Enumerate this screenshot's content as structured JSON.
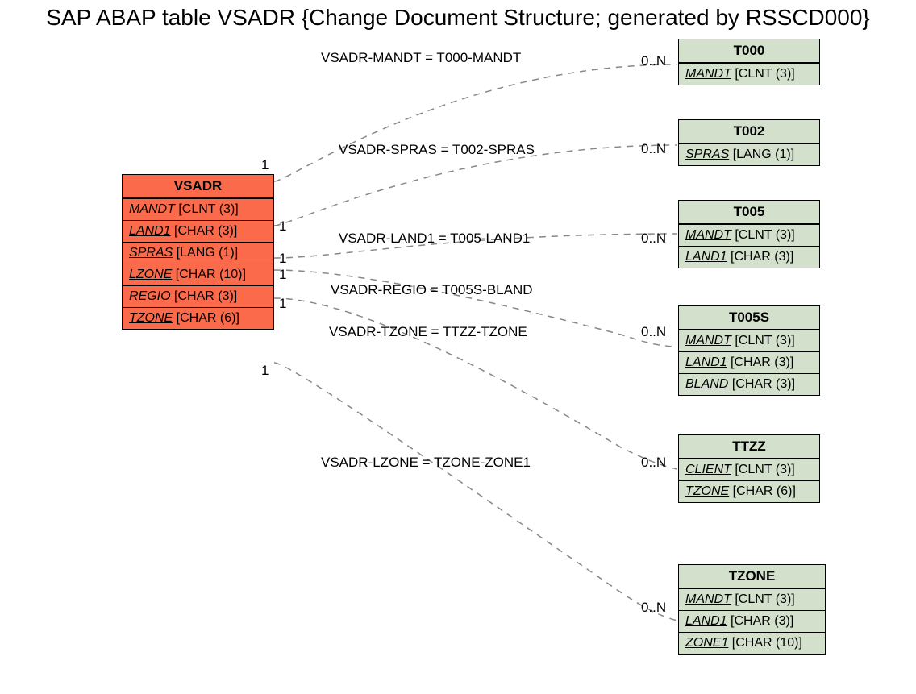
{
  "title": "SAP ABAP table VSADR {Change Document Structure; generated by RSSCD000}",
  "main": {
    "name": "VSADR",
    "fields": [
      {
        "f": "MANDT",
        "t": "[CLNT (3)]"
      },
      {
        "f": "LAND1",
        "t": "[CHAR (3)]"
      },
      {
        "f": "SPRAS",
        "t": "[LANG (1)]"
      },
      {
        "f": "LZONE",
        "t": "[CHAR (10)]"
      },
      {
        "f": "REGIO",
        "t": "[CHAR (3)]"
      },
      {
        "f": "TZONE",
        "t": "[CHAR (6)]"
      }
    ]
  },
  "refs": [
    {
      "name": "T000",
      "fields": [
        {
          "f": "MANDT",
          "t": "[CLNT (3)]"
        }
      ]
    },
    {
      "name": "T002",
      "fields": [
        {
          "f": "SPRAS",
          "t": "[LANG (1)]"
        }
      ]
    },
    {
      "name": "T005",
      "fields": [
        {
          "f": "MANDT",
          "t": "[CLNT (3)]"
        },
        {
          "f": "LAND1",
          "t": "[CHAR (3)]"
        }
      ]
    },
    {
      "name": "T005S",
      "fields": [
        {
          "f": "MANDT",
          "t": "[CLNT (3)]"
        },
        {
          "f": "LAND1",
          "t": "[CHAR (3)]"
        },
        {
          "f": "BLAND",
          "t": "[CHAR (3)]"
        }
      ]
    },
    {
      "name": "TTZZ",
      "fields": [
        {
          "f": "CLIENT",
          "t": "[CLNT (3)]"
        },
        {
          "f": "TZONE",
          "t": "[CHAR (6)]"
        }
      ]
    },
    {
      "name": "TZONE",
      "fields": [
        {
          "f": "MANDT",
          "t": "[CLNT (3)]"
        },
        {
          "f": "LAND1",
          "t": "[CHAR (3)]"
        },
        {
          "f": "ZONE1",
          "t": "[CHAR (10)]"
        }
      ]
    }
  ],
  "edges": [
    {
      "label": "VSADR-MANDT = T000-MANDT",
      "left": "1",
      "right": "0..N"
    },
    {
      "label": "VSADR-SPRAS = T002-SPRAS",
      "left": "1",
      "right": "0..N"
    },
    {
      "label": "VSADR-LAND1 = T005-LAND1",
      "left": "1",
      "right": "0..N"
    },
    {
      "label": "VSADR-REGIO = T005S-BLAND",
      "left": "1",
      "right": ""
    },
    {
      "label": "VSADR-TZONE = TTZZ-TZONE",
      "left": "1",
      "right": "0..N"
    },
    {
      "label": "VSADR-LZONE = TZONE-ZONE1",
      "left": "1",
      "right": "0..N"
    }
  ]
}
